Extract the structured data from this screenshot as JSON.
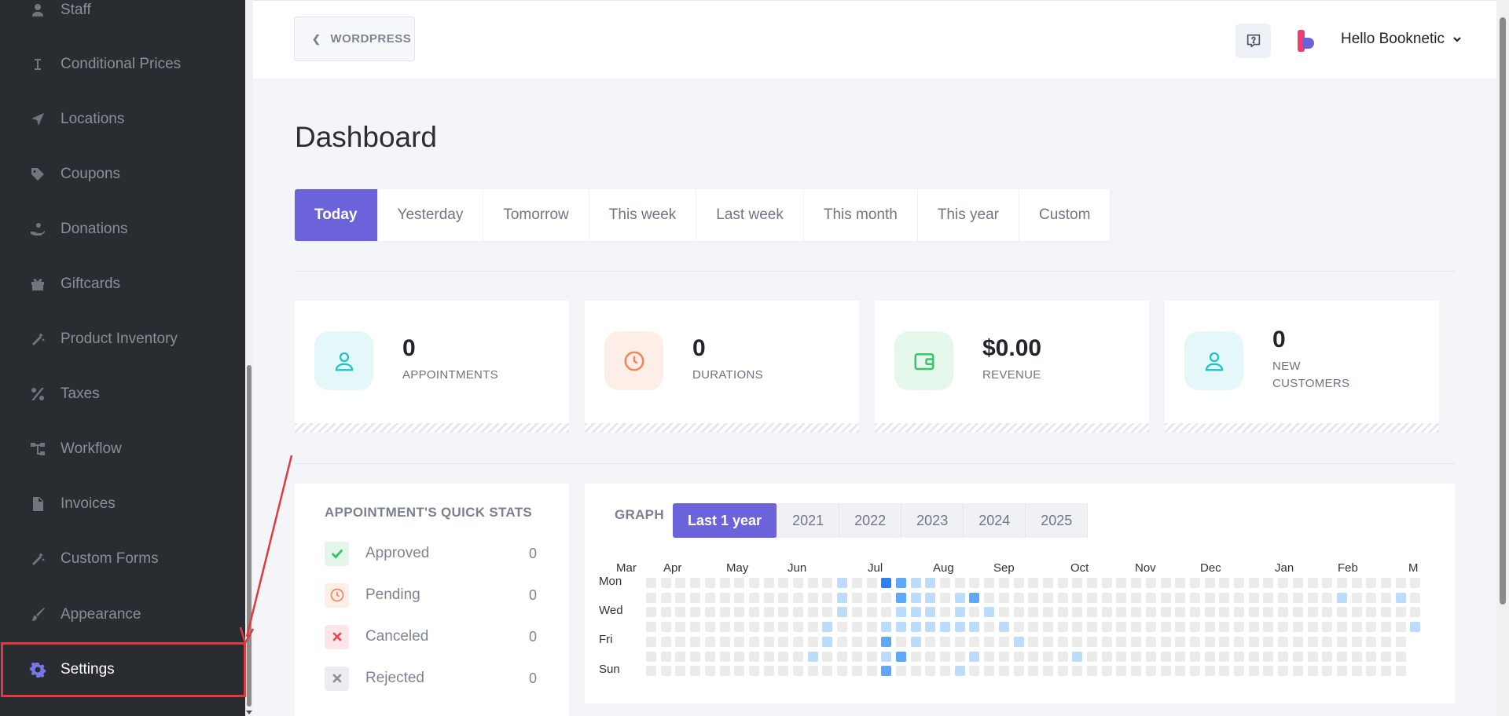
{
  "sidebar": {
    "items": [
      {
        "label": "Staff",
        "icon": "user-icon"
      },
      {
        "label": "Conditional Prices",
        "icon": "cursor-text-icon"
      },
      {
        "label": "Locations",
        "icon": "location-arrow-icon"
      },
      {
        "label": "Coupons",
        "icon": "tag-icon"
      },
      {
        "label": "Donations",
        "icon": "donation-hand-icon"
      },
      {
        "label": "Giftcards",
        "icon": "gift-icon"
      },
      {
        "label": "Product Inventory",
        "icon": "magic-wand-icon"
      },
      {
        "label": "Taxes",
        "icon": "percent-icon"
      },
      {
        "label": "Workflow",
        "icon": "workflow-icon"
      },
      {
        "label": "Invoices",
        "icon": "file-icon"
      },
      {
        "label": "Custom Forms",
        "icon": "magic-wand-icon"
      },
      {
        "label": "Appearance",
        "icon": "brush-icon"
      },
      {
        "label": "Settings",
        "icon": "gear-icon"
      }
    ],
    "active": "Settings"
  },
  "topbar": {
    "back_label": "WORDPRESS",
    "user_greeting": "Hello Booknetic"
  },
  "page": {
    "title": "Dashboard",
    "tabs": [
      "Today",
      "Yesterday",
      "Tomorrow",
      "This week",
      "Last week",
      "This month",
      "This year",
      "Custom"
    ],
    "active_tab": "Today"
  },
  "stats": [
    {
      "value": "0",
      "label": "APPOINTMENTS",
      "icon": "user-icon",
      "color": "#17c3c9"
    },
    {
      "value": "0",
      "label": "DURATIONS",
      "icon": "clock-icon",
      "color": "#f2835b"
    },
    {
      "value": "$0.00",
      "label": "REVENUE",
      "icon": "wallet-icon",
      "color": "#39c46c"
    },
    {
      "value": "0",
      "label": "NEW CUSTOMERS",
      "icon": "user-icon",
      "color": "#17c3c9"
    }
  ],
  "quick_stats": {
    "title": "APPOINTMENT'S QUICK STATS",
    "items": [
      {
        "label": "Approved",
        "value": "0",
        "icon": "check-icon",
        "color": "#39c46c"
      },
      {
        "label": "Pending",
        "value": "0",
        "icon": "clock-icon",
        "color": "#f2835b"
      },
      {
        "label": "Canceled",
        "value": "0",
        "icon": "close-icon",
        "color": "#e8455b"
      },
      {
        "label": "Rejected",
        "value": "0",
        "icon": "close-icon",
        "color": "#8a8f99"
      }
    ]
  },
  "graph": {
    "title": "GRAPH",
    "tabs": [
      "Last 1 year",
      "2021",
      "2022",
      "2023",
      "2024",
      "2025"
    ],
    "active_tab": "Last 1 year",
    "months": [
      "Mar",
      "Apr",
      "May",
      "Jun",
      "Jul",
      "Aug",
      "Sep",
      "Oct",
      "Nov",
      "Dec",
      "Jan",
      "Feb",
      "M"
    ],
    "days": [
      "Mon",
      "Wed",
      "Fri",
      "Sun"
    ],
    "colors": {
      "empty": "#ebebeb",
      "low": "#bcdcfb",
      "mid": "#5fa8f5",
      "high": "#2c7ff0"
    },
    "active_cells": [
      [
        13,
        0,
        "low"
      ],
      [
        16,
        0,
        "high"
      ],
      [
        17,
        0,
        "mid"
      ],
      [
        18,
        0,
        "low"
      ],
      [
        19,
        0,
        "low"
      ],
      [
        13,
        1,
        "low"
      ],
      [
        17,
        1,
        "mid"
      ],
      [
        18,
        1,
        "low"
      ],
      [
        19,
        1,
        "low"
      ],
      [
        21,
        1,
        "low"
      ],
      [
        22,
        1,
        "mid"
      ],
      [
        47,
        1,
        "low"
      ],
      [
        51,
        1,
        "low"
      ],
      [
        13,
        2,
        "low"
      ],
      [
        17,
        2,
        "low"
      ],
      [
        18,
        2,
        "low"
      ],
      [
        19,
        2,
        "low"
      ],
      [
        21,
        2,
        "low"
      ],
      [
        23,
        2,
        "low"
      ],
      [
        12,
        3,
        "low"
      ],
      [
        16,
        3,
        "low"
      ],
      [
        17,
        3,
        "low"
      ],
      [
        18,
        3,
        "low"
      ],
      [
        19,
        3,
        "low"
      ],
      [
        20,
        3,
        "low"
      ],
      [
        21,
        3,
        "low"
      ],
      [
        22,
        3,
        "low"
      ],
      [
        24,
        3,
        "low"
      ],
      [
        52,
        3,
        "low"
      ],
      [
        12,
        4,
        "low"
      ],
      [
        16,
        4,
        "mid"
      ],
      [
        18,
        4,
        "low"
      ],
      [
        25,
        4,
        "low"
      ],
      [
        11,
        5,
        "low"
      ],
      [
        16,
        5,
        "low"
      ],
      [
        17,
        5,
        "mid"
      ],
      [
        22,
        5,
        "low"
      ],
      [
        29,
        5,
        "low"
      ],
      [
        16,
        6,
        "mid"
      ],
      [
        21,
        6,
        "low"
      ]
    ]
  }
}
